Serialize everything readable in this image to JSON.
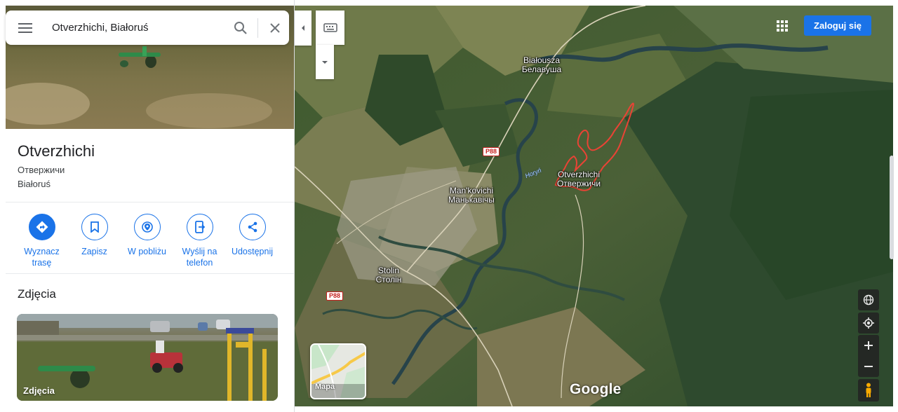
{
  "search": {
    "value": "Otverzhichi, Białoruś",
    "icons": [
      "menu-icon",
      "search-icon",
      "close-icon"
    ]
  },
  "place": {
    "title": "Otverzhichi",
    "local_name": "Отвержичи",
    "country": "Białoruś"
  },
  "actions": [
    {
      "label": "Wyznacz trasę",
      "icon": "directions-icon"
    },
    {
      "label": "Zapisz",
      "icon": "bookmark-icon"
    },
    {
      "label": "W pobliżu",
      "icon": "nearby-icon"
    },
    {
      "label": "Wyślij na telefon",
      "icon": "send-to-phone-icon"
    },
    {
      "label": "Udostępnij",
      "icon": "share-icon"
    }
  ],
  "photos": {
    "heading": "Zdjęcia",
    "card_label": "Zdjęcia"
  },
  "map": {
    "signin_label": "Zaloguj się",
    "layer_label": "Mapa",
    "logo": "Google",
    "labels": {
      "bialousza": "Białousza",
      "bialousza_cyr": "Белавуша",
      "otverzhichi": "Otverzhichi",
      "otverzhichi_cyr": "Отвержичи",
      "mankovichi": "Man'kovichi",
      "mankovichi_cyr": "Манькавічы",
      "stolin": "Stolin",
      "stolin_cyr": "Столін",
      "river": "Horyń"
    },
    "road_shields": [
      "P88",
      "P88"
    ],
    "accent_color": "#1a73e8",
    "highlight_color": "#ea4335"
  }
}
